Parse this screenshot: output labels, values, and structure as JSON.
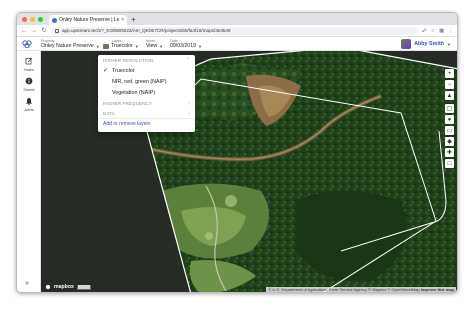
{
  "browser": {
    "tab_title": "Onley Nature Preserve | Lens",
    "tab_close": "×",
    "new_tab": "+",
    "url": "app.upstream.tech/?_KGf6W5023/Am_QKhE7CR/projects/80/fa4f18/maps/3e3549"
  },
  "header": {
    "property_label": "Property",
    "property_value": "Onley Nature Preserve",
    "layer_label": "Layer",
    "layer_value": "Truecolor",
    "mode_label": "Mode",
    "mode_value": "View",
    "date_label": "Date",
    "date_value": "09/03/2019",
    "user_name": "Abby Smith"
  },
  "sidebar": {
    "items": [
      {
        "label": "Notes",
        "icon": "notes-icon"
      },
      {
        "label": "Details",
        "icon": "info-icon"
      },
      {
        "label": "Alerts",
        "icon": "bell-icon"
      }
    ],
    "collapse_icon": "double-chevron-right-icon"
  },
  "layer_menu": {
    "section_high_res": "HIGHER RESOLUTION",
    "items": [
      {
        "label": "Truecolor",
        "checked": true
      },
      {
        "label": "NIR, red, green (NAIP)",
        "checked": false
      },
      {
        "label": "Vegetation (NAIP)",
        "checked": false
      }
    ],
    "section_high_freq": "HIGHER FREQUENCY",
    "section_data": "DATA",
    "add_remove": "Add or remove layers"
  },
  "map": {
    "logo_text": "mapbox",
    "attribution_1": "© U.S. Department of Agriculture, Farm Service Agency",
    "attribution_2": "© Mapbox © OpenStreetMap",
    "attribution_3": "Improve this map",
    "tools": [
      "zoom-in-icon",
      "zoom-out-icon",
      "compass-icon",
      "layers-icon",
      "pin-icon",
      "ruler-icon",
      "tag-icon",
      "eraser-icon",
      "box-icon"
    ]
  }
}
